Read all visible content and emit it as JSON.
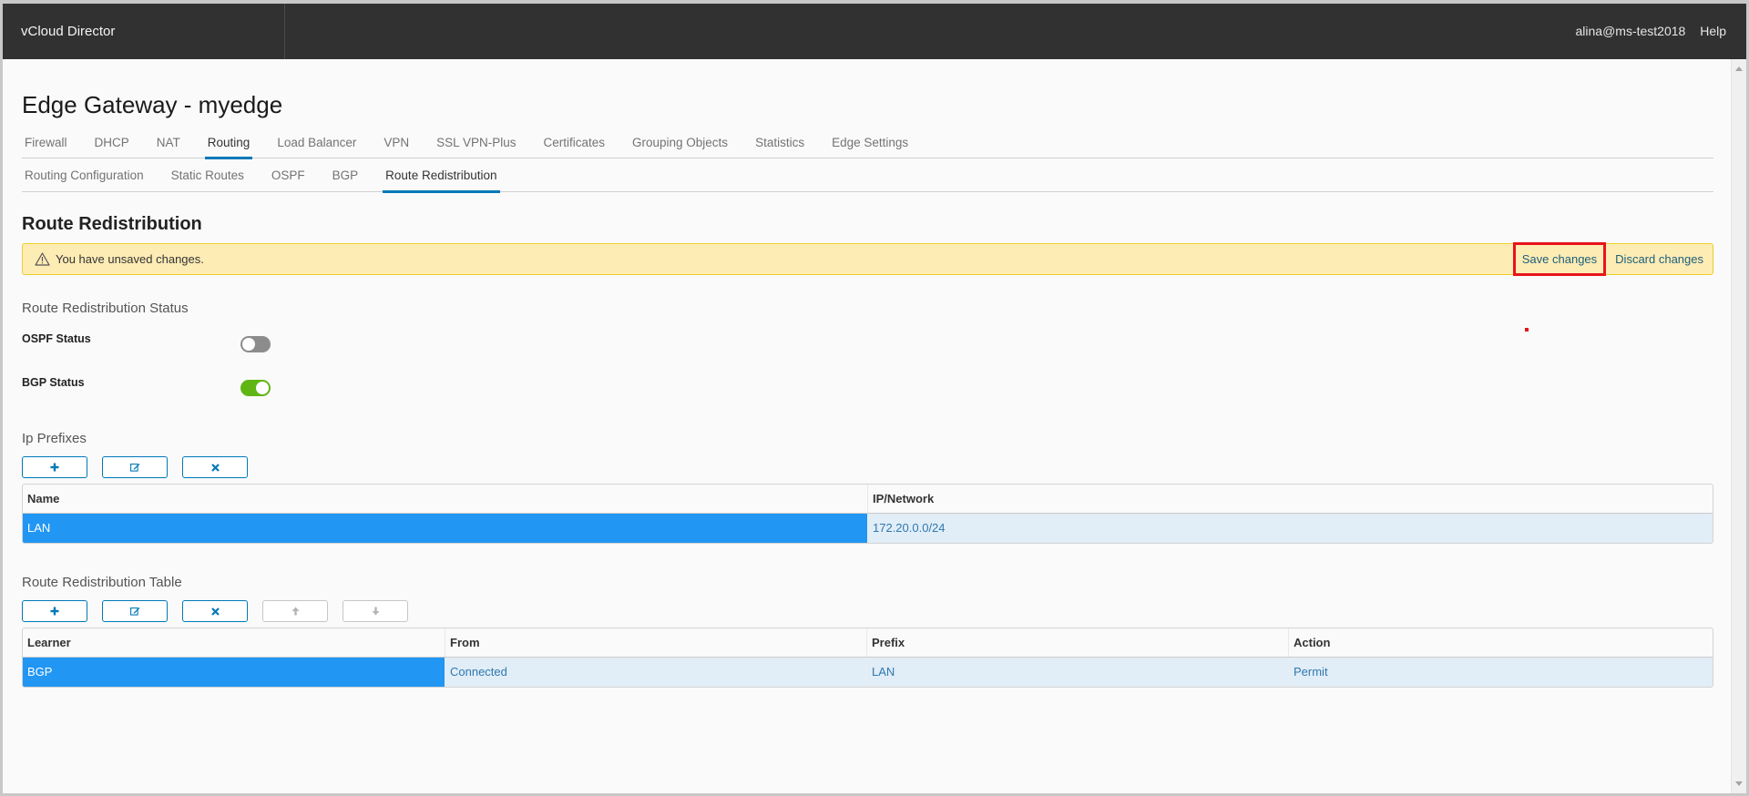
{
  "app": {
    "title": "vCloud Director",
    "user": "alina@ms-test2018",
    "help": "Help"
  },
  "page": {
    "title": "Edge Gateway - myedge"
  },
  "tabs": [
    {
      "label": "Firewall",
      "active": false
    },
    {
      "label": "DHCP",
      "active": false
    },
    {
      "label": "NAT",
      "active": false
    },
    {
      "label": "Routing",
      "active": true
    },
    {
      "label": "Load Balancer",
      "active": false
    },
    {
      "label": "VPN",
      "active": false
    },
    {
      "label": "SSL VPN-Plus",
      "active": false
    },
    {
      "label": "Certificates",
      "active": false
    },
    {
      "label": "Grouping Objects",
      "active": false
    },
    {
      "label": "Statistics",
      "active": false
    },
    {
      "label": "Edge Settings",
      "active": false
    }
  ],
  "subtabs": [
    {
      "label": "Routing Configuration",
      "active": false
    },
    {
      "label": "Static Routes",
      "active": false
    },
    {
      "label": "OSPF",
      "active": false
    },
    {
      "label": "BGP",
      "active": false
    },
    {
      "label": "Route Redistribution",
      "active": true
    }
  ],
  "section": {
    "title": "Route Redistribution"
  },
  "alert": {
    "icon": "warning-icon",
    "text": "You have unsaved changes.",
    "save": "Save changes",
    "discard": "Discard changes"
  },
  "status": {
    "title": "Route Redistribution Status",
    "ospf": {
      "label": "OSPF Status",
      "enabled": false
    },
    "bgp": {
      "label": "BGP Status",
      "enabled": true
    }
  },
  "ip_prefixes": {
    "title": "Ip Prefixes",
    "buttons": [
      "add-icon",
      "edit-icon",
      "delete-icon"
    ],
    "columns": [
      "Name",
      "IP/Network"
    ],
    "rows": [
      {
        "name": "LAN",
        "network": "172.20.0.0/24",
        "selected": true
      }
    ]
  },
  "redistribution_table": {
    "title": "Route Redistribution Table",
    "buttons": [
      "add-icon",
      "edit-icon",
      "delete-icon",
      "move-up-icon",
      "move-down-icon"
    ],
    "columns": [
      "Learner",
      "From",
      "Prefix",
      "Action"
    ],
    "rows": [
      {
        "learner": "BGP",
        "from": "Connected",
        "prefix": "LAN",
        "action": "Permit",
        "selected": true
      }
    ]
  },
  "colors": {
    "accent": "#0079b8",
    "selected_row": "#2196f3",
    "alert_bg": "#feecb5",
    "toggle_on": "#60b515",
    "highlight": "#e8141c"
  }
}
